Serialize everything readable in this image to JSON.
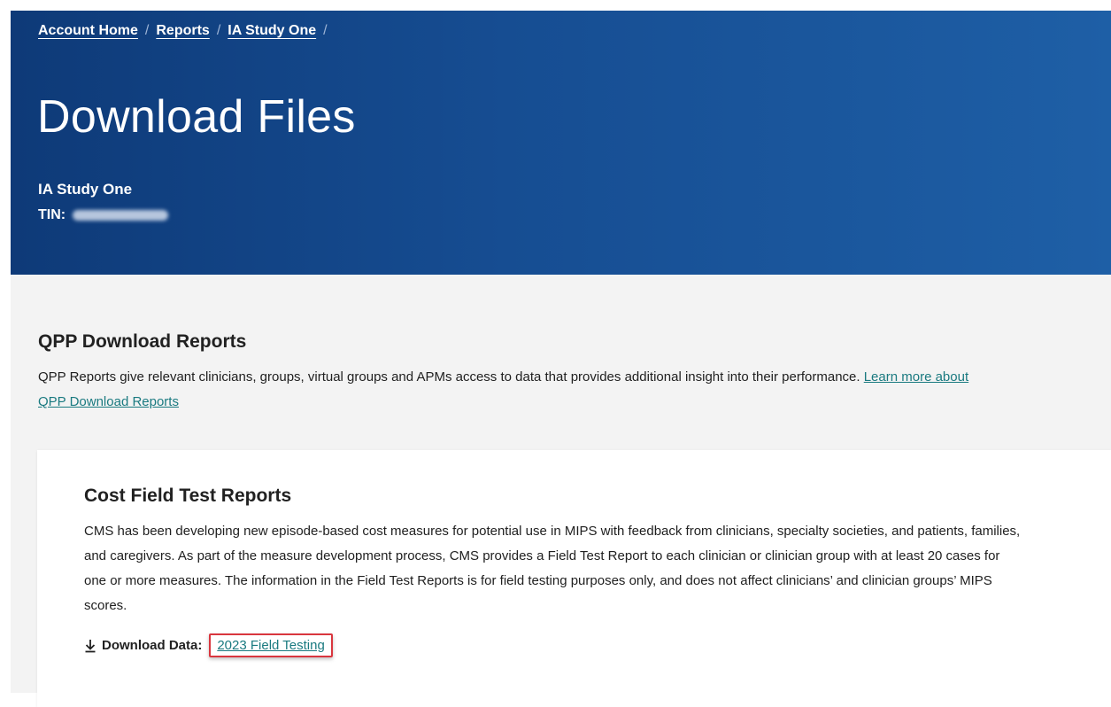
{
  "breadcrumb": {
    "items": [
      "Account Home",
      "Reports",
      "IA Study One"
    ],
    "separator": "/"
  },
  "header": {
    "title": "Download Files",
    "org_name": "IA Study One",
    "tin_label": "TIN:"
  },
  "reports_section": {
    "title": "QPP Download Reports",
    "description": "QPP Reports give relevant clinicians, groups, virtual groups and APMs access to data that provides additional insight into their performance.",
    "learn_more_link": "Learn more about QPP Download Reports"
  },
  "cost_card": {
    "title": "Cost Field Test Reports",
    "description": "CMS has been developing new episode-based cost measures for potential use in MIPS with feedback from clinicians, specialty societies, and patients, families, and caregivers. As part of the measure development process, CMS provides a Field Test Report to each clinician or clinician group with at least 20 cases for one or more measures. The information in the Field Test Reports is for field testing purposes only, and does not affect clinicians’ and clinician groups’ MIPS scores.",
    "download_label": "Download Data:",
    "download_link": "2023 Field Testing"
  },
  "colors": {
    "hero_start": "#0e3a78",
    "hero_end": "#1e5fa6",
    "link": "#1a7a80",
    "highlight": "#d9363e",
    "content_bg": "#f3f3f3"
  },
  "icons": {
    "download": "download-arrow-icon"
  }
}
